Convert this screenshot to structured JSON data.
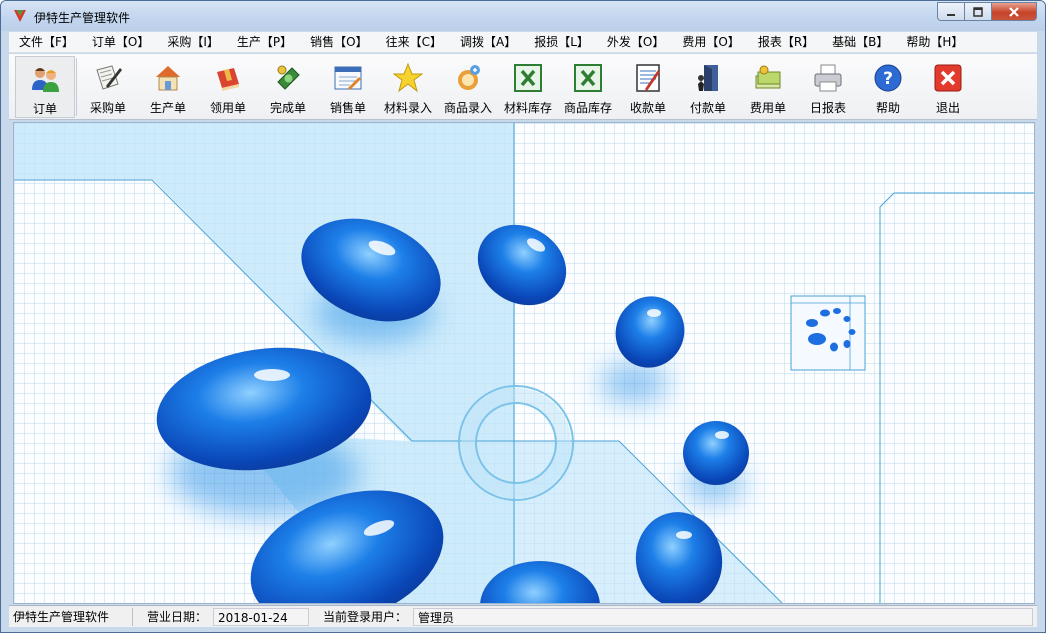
{
  "window": {
    "title": "伊特生产管理软件"
  },
  "menu": [
    {
      "label": "文件【F】"
    },
    {
      "label": "订单【O】"
    },
    {
      "label": "采购【I】"
    },
    {
      "label": "生产【P】"
    },
    {
      "label": "销售【O】"
    },
    {
      "label": "往来【C】"
    },
    {
      "label": "调拨【A】"
    },
    {
      "label": "报损【L】"
    },
    {
      "label": "外发【O】"
    },
    {
      "label": "费用【O】"
    },
    {
      "label": "报表【R】"
    },
    {
      "label": "基础【B】"
    },
    {
      "label": "帮助【H】"
    }
  ],
  "toolbar": [
    {
      "label": "订单",
      "icon": "people-icon"
    },
    {
      "label": "采购单",
      "icon": "scroll-pen-icon"
    },
    {
      "label": "生产单",
      "icon": "house-icon"
    },
    {
      "label": "领用单",
      "icon": "book-icon"
    },
    {
      "label": "完成单",
      "icon": "money-icon"
    },
    {
      "label": "销售单",
      "icon": "invoice-icon"
    },
    {
      "label": "材料录入",
      "icon": "star-icon"
    },
    {
      "label": "商品录入",
      "icon": "goods-icon"
    },
    {
      "label": "材料库存",
      "icon": "excel-icon"
    },
    {
      "label": "商品库存",
      "icon": "excel-icon"
    },
    {
      "label": "收款单",
      "icon": "notepad-icon"
    },
    {
      "label": "付款单",
      "icon": "door-icon"
    },
    {
      "label": "费用单",
      "icon": "cash-icon"
    },
    {
      "label": "日报表",
      "icon": "printer-icon"
    },
    {
      "label": "帮助",
      "icon": "help-icon"
    },
    {
      "label": "退出",
      "icon": "exit-icon"
    }
  ],
  "status": {
    "app_name": "伊特生产管理软件",
    "date_label": "营业日期：",
    "date_value": "2018-01-24",
    "user_label": "当前登录用户：",
    "user_value": "管理员"
  },
  "colors": {
    "accent": "#1a5fc8",
    "close": "#c7432a",
    "grid": "#a0c8e6"
  }
}
